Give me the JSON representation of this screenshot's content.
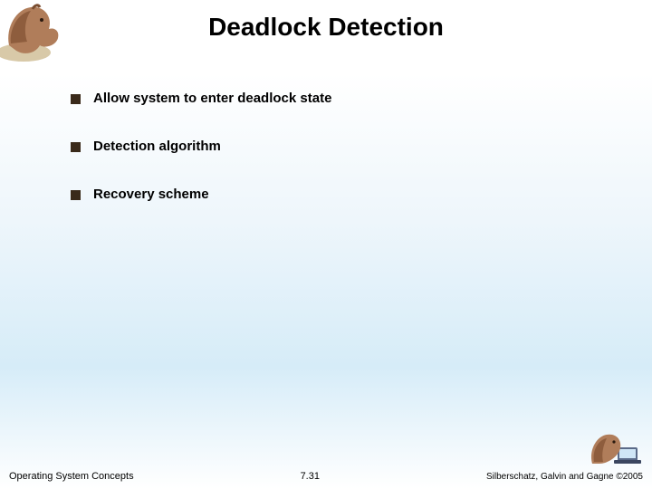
{
  "title": "Deadlock Detection",
  "bullets": [
    {
      "text": "Allow system to enter deadlock state"
    },
    {
      "text": "Detection algorithm"
    },
    {
      "text": "Recovery scheme"
    }
  ],
  "footer": {
    "left": "Operating System Concepts",
    "center": "7.31",
    "right": "Silberschatz, Galvin and Gagne ©2005"
  },
  "icons": {
    "mascot": "dinosaur-mascot"
  }
}
